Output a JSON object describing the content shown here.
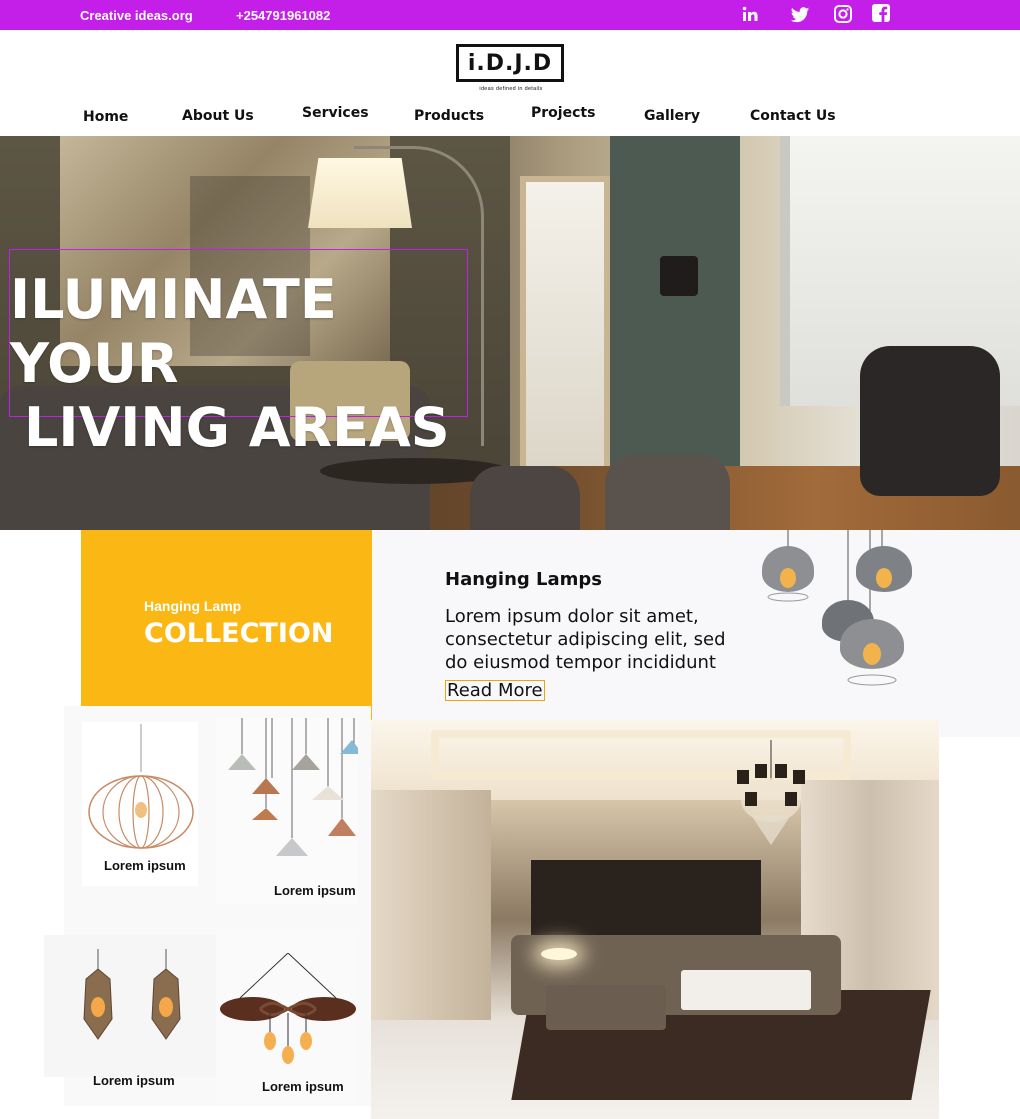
{
  "topbar": {
    "site": "Creative ideas.org",
    "phone": "+254791961082",
    "social": [
      "linkedin-icon",
      "twitter-icon",
      "instagram-icon",
      "facebook-icon"
    ],
    "color": "#c41fe8"
  },
  "logo": {
    "text": "i.D.J.D",
    "tagline": "ideas defined in details"
  },
  "nav": {
    "home": "Home",
    "about": "About Us",
    "services": "Services",
    "products": "Products",
    "projects": "Projects",
    "gallery": "Gallery",
    "contact": "Contact Us"
  },
  "hero": {
    "line1": "ILUMINATE YOUR",
    "line2": "LIVING AREAS"
  },
  "collection": {
    "small": "Hanging Lamp",
    "big": "COLLECTION",
    "color": "#fbb814"
  },
  "feature": {
    "heading": "Hanging Lamps",
    "body": "Lorem ipsum dolor sit amet, consectetur adipiscing elit, sed do eiusmod tempor incididunt",
    "button": "Read More"
  },
  "products": [
    {
      "label": "Lorem ipsum"
    },
    {
      "label": "Lorem ipsum"
    },
    {
      "label": "Lorem ipsum"
    },
    {
      "label": "Lorem ipsum"
    }
  ]
}
